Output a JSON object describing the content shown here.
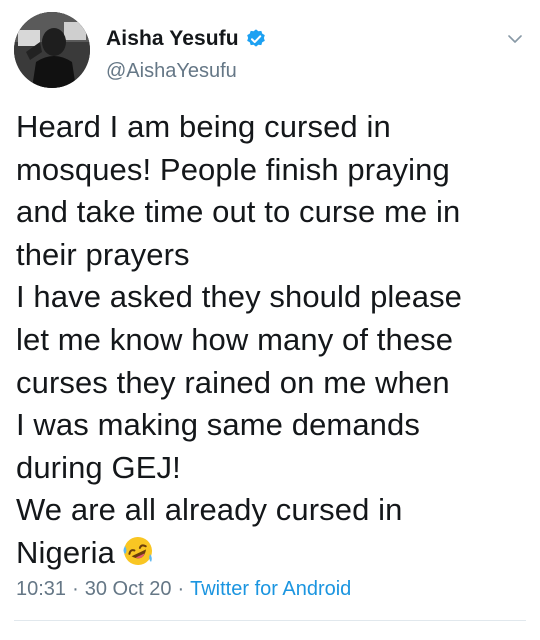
{
  "tweet": {
    "author": {
      "display_name": "Aisha Yesufu",
      "handle": "@AishaYesufu",
      "verified": true,
      "avatar_icon": "profile-photo"
    },
    "text": "Heard I am being cursed in\nmosques! People finish praying\nand take time out to curse me in\ntheir prayers\nI have asked they should please\nlet me know how many of these\ncurses they rained on me when\nI was making same demands\nduring GEJ!\nWe are all already cursed in\nNigeria",
    "emoji": "rolling-on-the-floor-laughing-emoji",
    "time": "10:31",
    "date": "30 Oct 20",
    "source": "Twitter for Android",
    "separator": "·"
  },
  "colors": {
    "text": "#14171a",
    "secondary": "#657786",
    "link": "#1b95e0",
    "verified": "#1da1f2"
  }
}
